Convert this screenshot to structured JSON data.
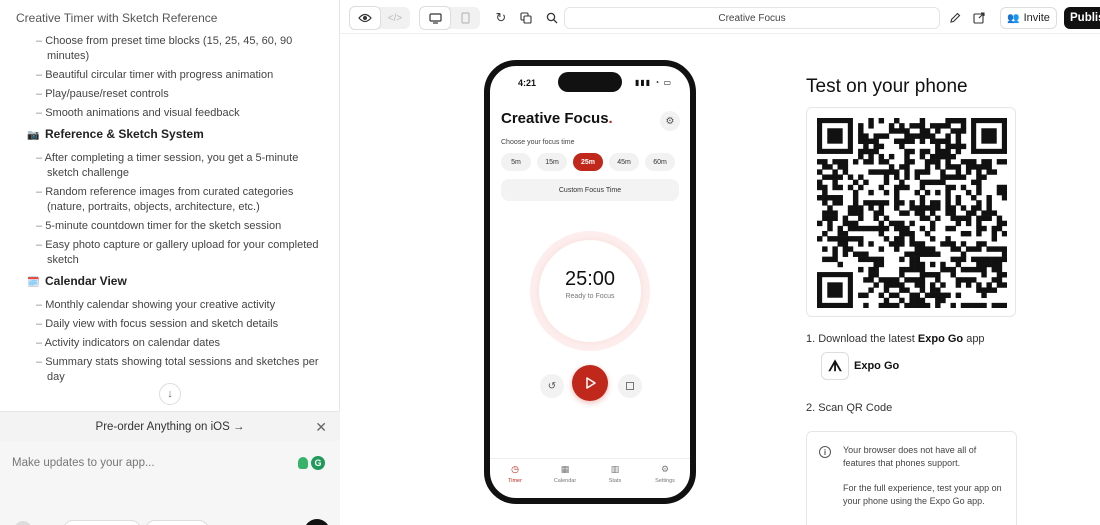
{
  "left": {
    "title": "Creative Timer with Sketch Reference",
    "items": [
      {
        "kind": "bullet",
        "text": "Choose from preset time blocks (15, 25, 45, 60, 90 minutes)"
      },
      {
        "kind": "bullet",
        "text": "Beautiful circular timer with progress animation"
      },
      {
        "kind": "bullet",
        "text": "Play/pause/reset controls"
      },
      {
        "kind": "bullet",
        "text": "Smooth animations and visual feedback"
      },
      {
        "kind": "heading",
        "emoji": "📷",
        "text": "Reference & Sketch System"
      },
      {
        "kind": "bullet",
        "text": "After completing a timer session, you get a 5-minute sketch challenge"
      },
      {
        "kind": "bullet",
        "text": "Random reference images from curated categories (nature, portraits, objects, architecture, etc.)"
      },
      {
        "kind": "bullet",
        "text": "5-minute countdown timer for the sketch session"
      },
      {
        "kind": "bullet",
        "text": "Easy photo capture or gallery upload for your completed sketch"
      },
      {
        "kind": "heading",
        "emoji": "🗓️",
        "text": "Calendar View"
      },
      {
        "kind": "bullet",
        "text": "Monthly calendar showing your creative activity"
      },
      {
        "kind": "bullet",
        "text": "Daily view with focus session and sketch details"
      },
      {
        "kind": "bullet",
        "text": "Activity indicators on calendar dates"
      },
      {
        "kind": "bullet",
        "text": "Summary stats showing total sessions and sketches per day"
      }
    ],
    "preorder": "Pre-order Anything on iOS →",
    "composer_placeholder": "Make updates to your app..."
  },
  "toolbar": {
    "url": "Creative Focus",
    "invite": "Invite",
    "publish": "Publish"
  },
  "phone": {
    "time": "4:21",
    "status_icons": "▮▮▮ ◔ ▭",
    "title": "Creative Focus",
    "title_dot": ".",
    "choose_label": "Choose your focus time",
    "chips": [
      "5m",
      "15m",
      "25m",
      "45m",
      "60m"
    ],
    "selected_chip": 2,
    "custom_label": "Custom Focus Time",
    "timer": "25:00",
    "timer_status": "Ready to Focus",
    "tabs": [
      {
        "label": "Timer",
        "icon": "◷"
      },
      {
        "label": "Calendar",
        "icon": "▦"
      },
      {
        "label": "Stats",
        "icon": "▥"
      },
      {
        "label": "Settings",
        "icon": "⚙"
      }
    ],
    "active_tab": 0
  },
  "right": {
    "title": "Test on your phone",
    "step1_prefix": "1. Download the latest ",
    "step1_bold": "Expo Go",
    "step1_suffix": " app",
    "expo_label": "Expo Go",
    "step2": "2. Scan QR Code",
    "info_p1": "Your browser does not have all of features that phones support.",
    "info_p2": "For the full experience, test your app on your phone using the Expo Go app."
  },
  "colors": {
    "accent": "#c0281b"
  }
}
